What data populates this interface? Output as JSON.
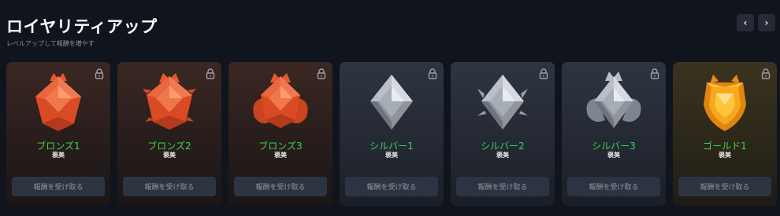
{
  "header": {
    "title": "ロイヤリティアップ",
    "subtitle": "レベルアップして報酬を増やす",
    "prev_icon": "chevron-left-icon",
    "next_icon": "chevron-right-icon",
    "prev_label": "‹",
    "next_label": "›"
  },
  "colors": {
    "rank_name": "#3fd64f",
    "bronze": "#e0552f",
    "silver": "#b9bec8",
    "gold": "#f2a21a",
    "button_bg": "#2d3441"
  },
  "cards": [
    {
      "name": "ブロンズ1",
      "reward": "褒美",
      "button": "報酬を受け取る",
      "tier": "bronze",
      "level": 1,
      "locked": true
    },
    {
      "name": "ブロンズ2",
      "reward": "褒美",
      "button": "報酬を受け取る",
      "tier": "bronze",
      "level": 2,
      "locked": true
    },
    {
      "name": "ブロンズ3",
      "reward": "褒美",
      "button": "報酬を受け取る",
      "tier": "bronze",
      "level": 3,
      "locked": true
    },
    {
      "name": "シルバー1",
      "reward": "褒美",
      "button": "報酬を受け取る",
      "tier": "silver",
      "level": 1,
      "locked": true
    },
    {
      "name": "シルバー2",
      "reward": "褒美",
      "button": "報酬を受け取る",
      "tier": "silver",
      "level": 2,
      "locked": true
    },
    {
      "name": "シルバー3",
      "reward": "褒美",
      "button": "報酬を受け取る",
      "tier": "silver",
      "level": 3,
      "locked": true
    },
    {
      "name": "ゴールド1",
      "reward": "褒美",
      "button": "報酬を受け取る",
      "tier": "gold",
      "level": 1,
      "locked": true
    }
  ]
}
